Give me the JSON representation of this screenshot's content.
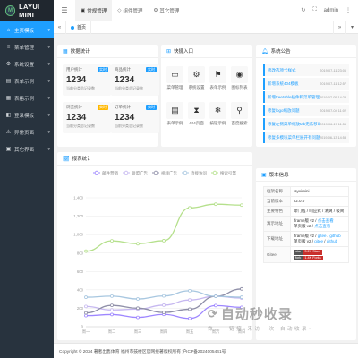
{
  "brand": {
    "logo_text": "LAYUI MINI",
    "logo_mark": "M"
  },
  "colors": {
    "accent": "#1e9fff",
    "sidebar_bg": "#28333e",
    "sidebar_logo_bg": "#20272f"
  },
  "sidebar": {
    "items": [
      {
        "label": "主页模板",
        "icon": "home-icon",
        "glyph": "⌂",
        "active": true
      },
      {
        "label": "菜单管理",
        "icon": "menu-icon",
        "glyph": "≡",
        "active": false
      },
      {
        "label": "系统设置",
        "icon": "gear-icon",
        "glyph": "⚙",
        "active": false
      },
      {
        "label": "表单示例",
        "icon": "form-icon",
        "glyph": "▤",
        "active": false
      },
      {
        "label": "表格示例",
        "icon": "table-icon",
        "glyph": "▦",
        "active": false
      },
      {
        "label": "登录模板",
        "icon": "login-icon",
        "glyph": "◧",
        "active": false
      },
      {
        "label": "异常页面",
        "icon": "warning-icon",
        "glyph": "⚠",
        "active": false
      },
      {
        "label": "其它界面",
        "icon": "grid-icon",
        "glyph": "▣",
        "active": false
      }
    ]
  },
  "header": {
    "tabs": [
      {
        "label": "常规管理",
        "glyph": "▣",
        "active": true
      },
      {
        "label": "组件管理",
        "glyph": "◇",
        "active": false
      },
      {
        "label": "其它管理",
        "glyph": "⚙",
        "active": false
      }
    ],
    "user": "admin"
  },
  "tabbar": {
    "tabs": [
      {
        "label": "首页"
      }
    ]
  },
  "stats": {
    "title": "数据统计",
    "items": [
      {
        "label": "用户统计",
        "value": "1234",
        "sub": "当前分类总记录数",
        "badge": "实时",
        "badge_color": "#1e9fff"
      },
      {
        "label": "商品统计",
        "value": "1234",
        "sub": "当前分类总记录数",
        "badge": "实时",
        "badge_color": "#1e9fff"
      },
      {
        "label": "浏览统计",
        "value": "1234",
        "sub": "当前分类总记录数",
        "badge": "实时",
        "badge_color": "#ffb800"
      },
      {
        "label": "订单统计",
        "value": "1234",
        "sub": "当前分类总记录数",
        "badge": "实时",
        "badge_color": "#1e9fff"
      }
    ]
  },
  "quick": {
    "title": "快捷入口",
    "items": [
      {
        "label": "菜单管理",
        "icon": "window-icon",
        "glyph": "▭"
      },
      {
        "label": "系统设置",
        "icon": "gear-icon",
        "glyph": "⚙"
      },
      {
        "label": "表单示例",
        "icon": "flag-icon",
        "glyph": "⚑"
      },
      {
        "label": "图标列表",
        "icon": "target-icon",
        "glyph": "◉"
      },
      {
        "label": "表单示例",
        "icon": "file-icon",
        "glyph": "▤"
      },
      {
        "label": "404页面",
        "icon": "hourglass-icon",
        "glyph": "⧗"
      },
      {
        "label": "按钮示例",
        "icon": "snowflake-icon",
        "glyph": "❄"
      },
      {
        "label": "百度搜索",
        "icon": "search-icon",
        "glyph": "⚲"
      }
    ]
  },
  "notice": {
    "title": "系统公告",
    "items": [
      {
        "title": "修改选项卡样式",
        "time": "2019-07-11 23:06"
      },
      {
        "title": "新增系统404模板",
        "time": "2019-07-11 12:57"
      },
      {
        "title": "新增treetable插件和菜单管理",
        "time": "2019-07-05 14:28"
      },
      {
        "title": "修复logo缩放问题",
        "time": "2019-07-04 11:02"
      },
      {
        "title": "修复左侧菜单缩放tab无法移动",
        "time": "2019-06-17 11:55"
      },
      {
        "title": "修复多模块菜单栏展开有问题",
        "time": "2019-06-13 14:53"
      }
    ]
  },
  "report": {
    "title": "报表统计"
  },
  "chart_data": {
    "type": "line",
    "categories": [
      "周一",
      "周二",
      "周三",
      "周四",
      "周五",
      "周六",
      "周日"
    ],
    "ylim": [
      0,
      1400
    ],
    "yticks": [
      "1,400",
      "1,200",
      "1,000",
      "800",
      "600",
      "400",
      "200",
      "0"
    ],
    "xlabel": "",
    "ylabel": "",
    "legend": [
      "邮件营销",
      "联盟广告",
      "视频广告",
      "直接访问",
      "搜索引擎"
    ],
    "series": [
      {
        "name": "邮件营销",
        "values": [
          120,
          132,
          101,
          134,
          90,
          230,
          210
        ],
        "color": "#9e87ff"
      },
      {
        "name": "联盟广告",
        "values": [
          220,
          182,
          191,
          234,
          290,
          330,
          310
        ],
        "color": "#c6b8f0"
      },
      {
        "name": "视频广告",
        "values": [
          150,
          232,
          201,
          154,
          190,
          330,
          410
        ],
        "color": "#8f8fa8"
      },
      {
        "name": "直接访问",
        "values": [
          320,
          332,
          301,
          334,
          390,
          330,
          320
        ],
        "color": "#a8c7e0"
      },
      {
        "name": "搜索引擎",
        "values": [
          820,
          932,
          901,
          934,
          1290,
          1330,
          1320
        ],
        "color": "#b5e08c"
      }
    ]
  },
  "version": {
    "title": "版本信息",
    "rows": [
      {
        "key": "框架名称",
        "value": "layuimini"
      },
      {
        "key": "当前版本",
        "value": "v2.0.0"
      },
      {
        "key": "主要特色",
        "value": "零门槛 / 响应式 / 清爽 / 极简"
      },
      {
        "key": "演示地址",
        "value": "iframe版 v2",
        "link1": "点击查看",
        "value2": "单页版 v2",
        "link2": "点击查看"
      },
      {
        "key": "下载地址",
        "value": "iframe版 v2",
        "link1": "gitee",
        "link1b": "github",
        "value2": "单页版 v2",
        "link2": "gitee",
        "link2b": "github"
      },
      {
        "key": "Gitee",
        "badge1_l": "star",
        "badge1_r": "3.2K Stars",
        "badge2_l": "fork",
        "badge2_r": "1.4K Forks"
      }
    ]
  },
  "footer": {
    "text": "Copyright © 2024 著者出售体育 福州市鼓楼区官网接著版权所有 沪ICP备2024005441号"
  },
  "watermark": {
    "big": "自动秒收录",
    "small": "做 上 一 链 接 · 来 访 一 次 · 自 动 收 录 ·"
  }
}
